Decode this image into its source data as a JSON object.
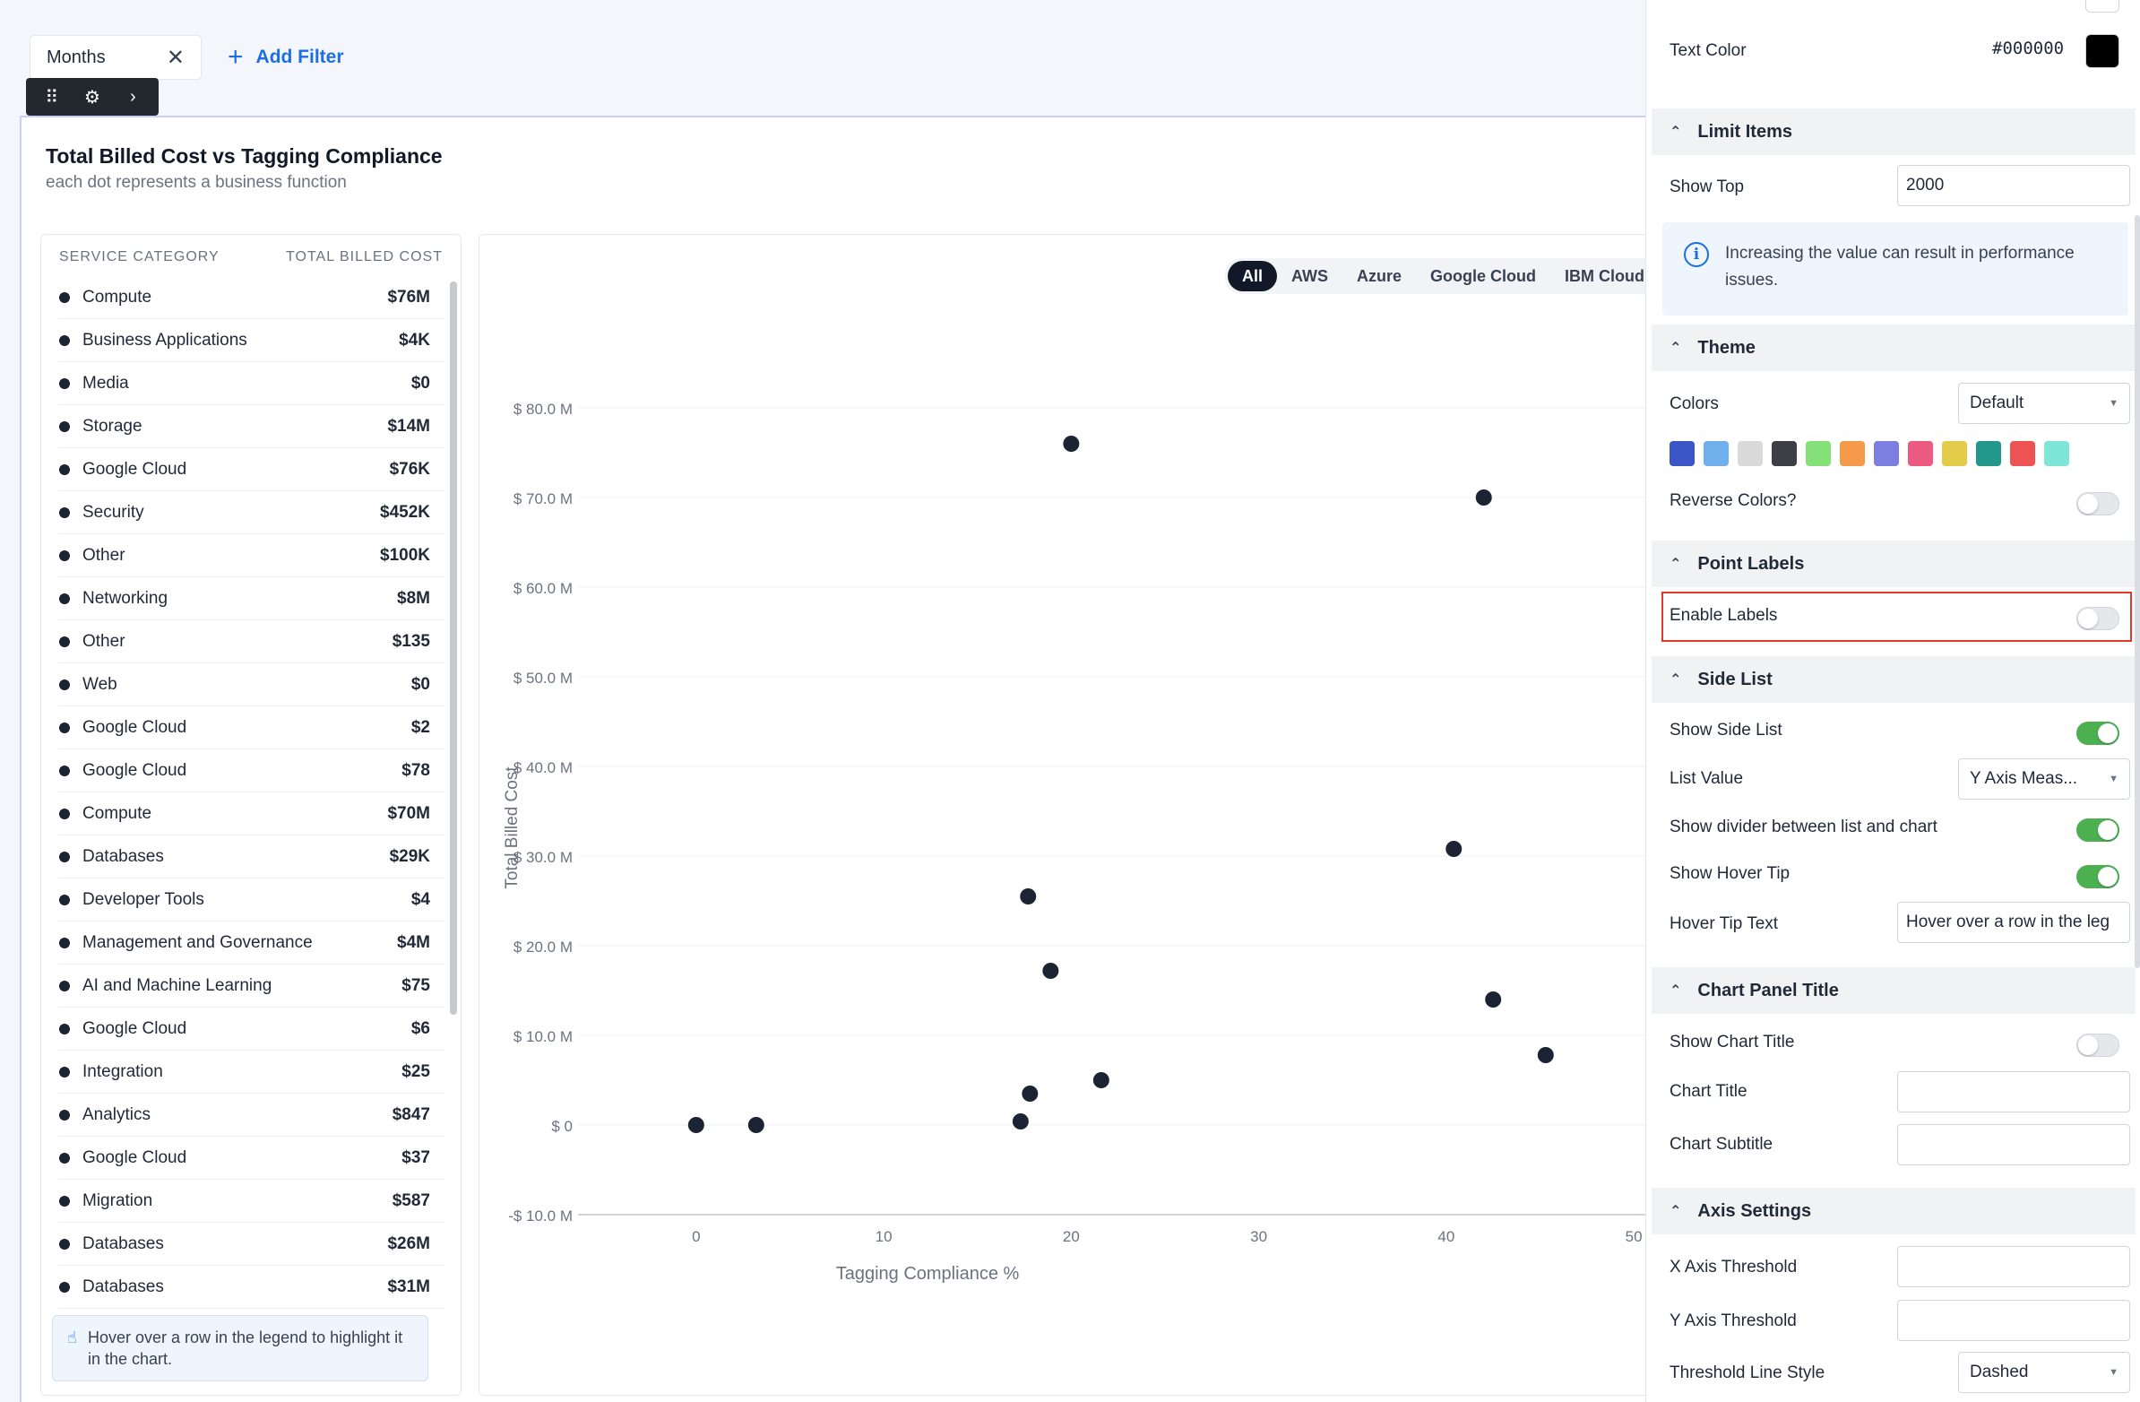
{
  "filters": {
    "chip_label": "Months",
    "chip_close": "✕",
    "add_filter_label": "Add Filter",
    "add_filter_icon": "+"
  },
  "toolbar": {
    "drag": "⠿",
    "settings": "⚙",
    "expand": "›"
  },
  "card": {
    "title": "Total Billed Cost vs Tagging Compliance",
    "subtitle": "each dot represents a business function"
  },
  "legend": {
    "col_category": "SERVICE CATEGORY",
    "col_cost": "TOTAL BILLED COST",
    "items": [
      {
        "label": "Compute",
        "value": "$76M"
      },
      {
        "label": "Business Applications",
        "value": "$4K"
      },
      {
        "label": "Media",
        "value": "$0"
      },
      {
        "label": "Storage",
        "value": "$14M"
      },
      {
        "label": "Google Cloud",
        "value": "$76K"
      },
      {
        "label": "Security",
        "value": "$452K"
      },
      {
        "label": "Other",
        "value": "$100K"
      },
      {
        "label": "Networking",
        "value": "$8M"
      },
      {
        "label": "Other",
        "value": "$135"
      },
      {
        "label": "Web",
        "value": "$0"
      },
      {
        "label": "Google Cloud",
        "value": "$2"
      },
      {
        "label": "Google Cloud",
        "value": "$78"
      },
      {
        "label": "Compute",
        "value": "$70M"
      },
      {
        "label": "Databases",
        "value": "$29K"
      },
      {
        "label": "Developer Tools",
        "value": "$4"
      },
      {
        "label": "Management and Governance",
        "value": "$4M"
      },
      {
        "label": "AI and Machine Learning",
        "value": "$75"
      },
      {
        "label": "Google Cloud",
        "value": "$6"
      },
      {
        "label": "Integration",
        "value": "$25"
      },
      {
        "label": "Analytics",
        "value": "$847"
      },
      {
        "label": "Google Cloud",
        "value": "$37"
      },
      {
        "label": "Migration",
        "value": "$587"
      },
      {
        "label": "Databases",
        "value": "$26M"
      },
      {
        "label": "Databases",
        "value": "$31M"
      }
    ],
    "hover_tip": "Hover over a row in the legend to highlight it in the chart."
  },
  "provider_tabs": [
    "All",
    "AWS",
    "Azure",
    "Google Cloud",
    "IBM Cloud"
  ],
  "chart_data": {
    "type": "scatter",
    "xlabel": "Tagging Compliance %",
    "ylabel": "Total Billed Cost",
    "x_ticks": [
      "0",
      "10",
      "20",
      "30",
      "40",
      "50"
    ],
    "y_ticks": [
      "-$ 10.0 M",
      "$ 0",
      "$ 10.0 M",
      "$ 20.0 M",
      "$ 30.0 M",
      "$ 40.0 M",
      "$ 50.0 M",
      "$ 60.0 M",
      "$ 70.0 M",
      "$ 80.0 M"
    ],
    "xlim": [
      -6.3,
      52
    ],
    "ylim": [
      -10,
      80
    ],
    "points": [
      {
        "x": 20,
        "y": 76
      },
      {
        "x": 42,
        "y": 70
      },
      {
        "x": 40.4,
        "y": 30.8
      },
      {
        "x": 17.7,
        "y": 25.5
      },
      {
        "x": 18.9,
        "y": 17.2
      },
      {
        "x": 42.5,
        "y": 14
      },
      {
        "x": 45.3,
        "y": 7.8
      },
      {
        "x": 21.6,
        "y": 5
      },
      {
        "x": 17.8,
        "y": 3.5
      },
      {
        "x": 17.3,
        "y": 0.4
      },
      {
        "x": 0,
        "y": 0
      },
      {
        "x": 3.2,
        "y": 0
      }
    ],
    "point_color": "#1c2433",
    "grid": true
  },
  "settings": {
    "text_color_label": "Text Color",
    "text_color_value": "#000000",
    "limit_items": {
      "title": "Limit Items",
      "show_top_label": "Show Top",
      "show_top_value": "2000",
      "info": "Increasing the value can result in performance issues.",
      "info_icon": "i"
    },
    "theme": {
      "title": "Theme",
      "colors_label": "Colors",
      "colors_value": "Default",
      "swatches": [
        "#3b55c6",
        "#6fb0ec",
        "#d9d9d9",
        "#3d3f44",
        "#86e07a",
        "#f59a4b",
        "#7c7fe0",
        "#ec5a82",
        "#e3cc4a",
        "#23978c",
        "#ee5353",
        "#7ee6d8"
      ],
      "reverse_label": "Reverse Colors?"
    },
    "point_labels": {
      "title": "Point Labels",
      "enable_label": "Enable Labels"
    },
    "side_list": {
      "title": "Side List",
      "show_side_list": "Show Side List",
      "list_value_label": "List Value",
      "list_value": "Y Axis Meas...",
      "divider_label": "Show divider between list and chart",
      "hover_tip_label": "Show Hover Tip",
      "hover_tip_text_label": "Hover Tip Text",
      "hover_tip_text_value": "Hover over a row in the leg"
    },
    "chart_panel_title": {
      "title": "Chart Panel Title",
      "show_chart_title": "Show Chart Title",
      "chart_title_label": "Chart Title",
      "chart_subtitle_label": "Chart Subtitle"
    },
    "axis_settings": {
      "title": "Axis Settings",
      "x_threshold_label": "X Axis Threshold",
      "y_threshold_label": "Y Axis Threshold",
      "line_style_label": "Threshold Line Style",
      "line_style_value": "Dashed"
    },
    "section_chevron": "⌃",
    "select_caret": "▼"
  }
}
